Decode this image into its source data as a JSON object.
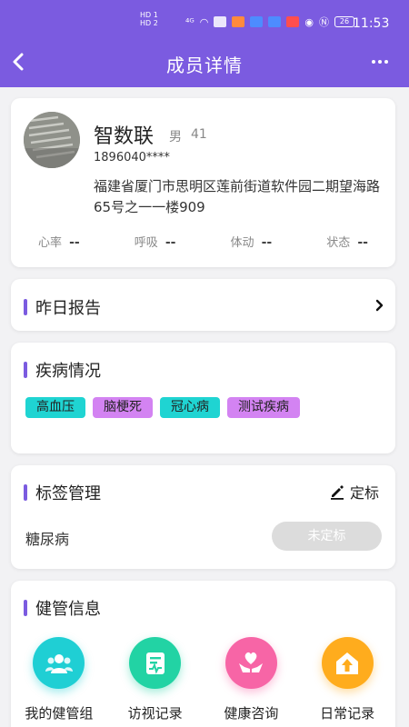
{
  "status_bar": {
    "left_badges": [
      "HD 1",
      "HD 2"
    ],
    "battery": "26",
    "time": "11:53"
  },
  "header": {
    "title": "成员详情"
  },
  "profile": {
    "name": "智数联",
    "gender": "男",
    "age": "41",
    "phone": "1896040****",
    "address": "福建省厦门市思明区莲前街道软件园二期望海路65号之一一楼909",
    "vitals": [
      {
        "label": "心率",
        "value": "--"
      },
      {
        "label": "呼吸",
        "value": "--"
      },
      {
        "label": "体动",
        "value": "--"
      },
      {
        "label": "状态",
        "value": "--"
      }
    ]
  },
  "report": {
    "title": "昨日报告"
  },
  "disease": {
    "title": "疾病情况",
    "tags": [
      {
        "label": "高血压",
        "color": "#1fd4d2"
      },
      {
        "label": "脑梗死",
        "color": "#d383f2"
      },
      {
        "label": "冠心病",
        "color": "#1fd4d2"
      },
      {
        "label": "测试疾病",
        "color": "#d383f2"
      }
    ]
  },
  "tag_management": {
    "title": "标签管理",
    "action_label": "定标",
    "row_label": "糖尿病",
    "status_label": "未定标"
  },
  "health_info": {
    "title": "健管信息",
    "items": [
      {
        "label": "我的健管组",
        "icon": "group-icon",
        "color": "#1fcfd4"
      },
      {
        "label": "访视记录",
        "icon": "visit-record-icon",
        "color": "#22d3a4"
      },
      {
        "label": "健康咨询",
        "icon": "heart-hands-icon",
        "color": "#f765a6"
      },
      {
        "label": "日常记录",
        "icon": "home-up-icon",
        "color": "#ffac1d"
      }
    ]
  },
  "colors": {
    "brand": "#7b5be0",
    "background": "#f2f2f4"
  }
}
